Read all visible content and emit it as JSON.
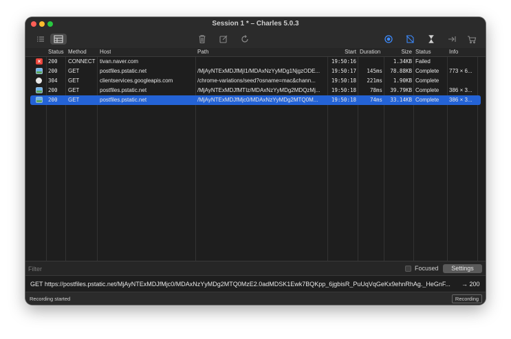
{
  "window": {
    "title": "Session 1 * – Charles 5.0.3"
  },
  "toolbar": {
    "icons": [
      "list-view-icon",
      "structure-view-icon",
      "trash-icon",
      "edit-icon",
      "refresh-icon",
      "record-icon",
      "ssl-proxying-icon",
      "throttle-icon",
      "breakpoints-icon",
      "cart-icon"
    ]
  },
  "table": {
    "columns": [
      "Status",
      "Method",
      "Host",
      "Path",
      "Start",
      "Duration",
      "Size",
      "Status",
      "Info"
    ],
    "rows": [
      {
        "icon": "failed-icon",
        "status": "200",
        "method": "CONNECT",
        "host": "tivan.naver.com",
        "path": "",
        "start": "19:50:16",
        "duration": "",
        "size": "1.34KB",
        "state": "Failed",
        "info": ""
      },
      {
        "icon": "image-icon",
        "status": "200",
        "method": "GET",
        "host": "postfiles.pstatic.net",
        "path": "/MjAyNTExMDJfMjI1/MDAxNzYyMDg1NjgzODE...",
        "start": "19:50:17",
        "duration": "145ms",
        "size": "78.88KB",
        "state": "Complete",
        "info": "773 × 6..."
      },
      {
        "icon": "not-modified-icon",
        "status": "304",
        "method": "GET",
        "host": "clientservices.googleapis.com",
        "path": "/chrome-variations/seed?osname=mac&chann...",
        "start": "19:50:18",
        "duration": "221ms",
        "size": "1.90KB",
        "state": "Complete",
        "info": ""
      },
      {
        "icon": "image-icon",
        "status": "200",
        "method": "GET",
        "host": "postfiles.pstatic.net",
        "path": "/MjAyNTExMDJfMTIz/MDAxNzYyMDg2MDQzMj...",
        "start": "19:50:18",
        "duration": "78ms",
        "size": "39.79KB",
        "state": "Complete",
        "info": "386 × 3..."
      },
      {
        "icon": "image-icon",
        "status": "200",
        "method": "GET",
        "host": "postfiles.pstatic.net",
        "path": "/MjAyNTExMDJfMjc0/MDAxNzYyMDg2MTQ0M...",
        "start": "19:50:18",
        "duration": "74ms",
        "size": "33.14KB",
        "state": "Complete",
        "info": "386 × 3...",
        "selected": true
      }
    ]
  },
  "filter": {
    "label": "Filter",
    "focused_label": "Focused",
    "settings_label": "Settings"
  },
  "request_line": {
    "text": "GET https://postfiles.pstatic.net/MjAyNTExMDJfMjc0/MDAxNzYyMDg2MTQ0MzE2.0adMDSK1Ewk7BQKpp_6jgbisR_PuUqVqGeKx9ehnRhAg._HeGnF...",
    "status": "→ 200"
  },
  "statusbar": {
    "text": "Recording started",
    "recording_label": "Recording"
  }
}
